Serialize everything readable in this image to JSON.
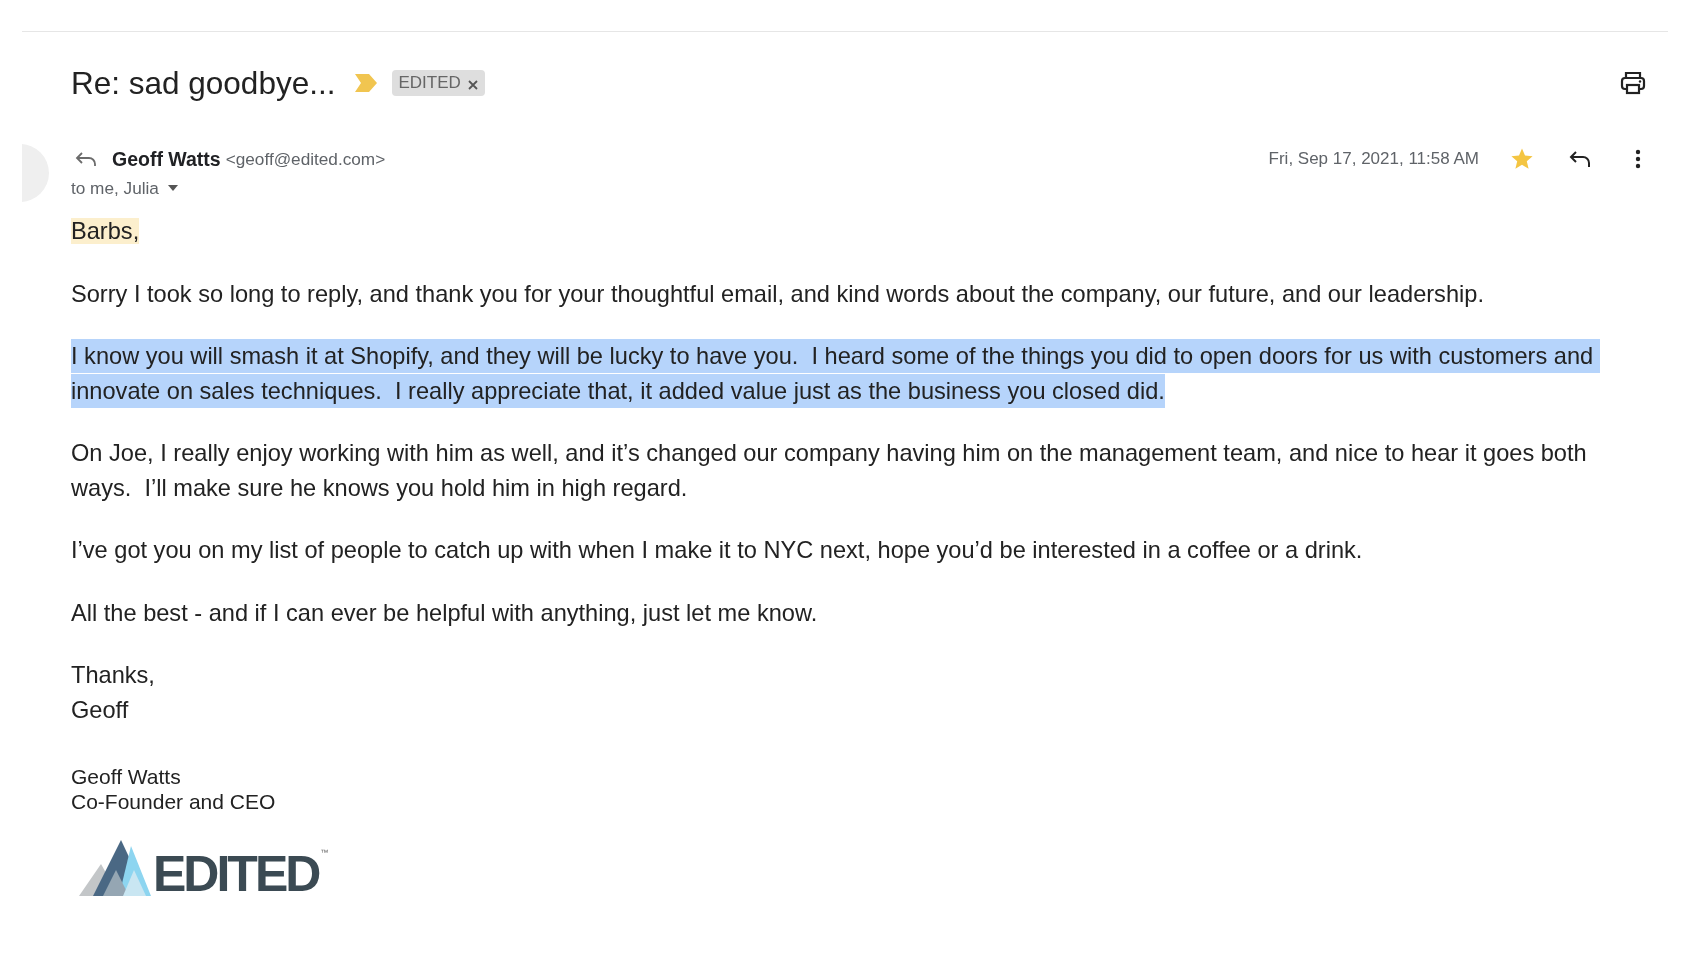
{
  "subject": {
    "title": "Re: sad goodbye...",
    "important": true,
    "labels": [
      {
        "text": "EDITED"
      }
    ]
  },
  "message": {
    "sender_name": "Geoff Watts",
    "sender_email": "<geoff@edited.com>",
    "recipients": "to me, Julia",
    "date": "Fri, Sep 17, 2021, 11:58 AM",
    "starred": true
  },
  "body": {
    "greeting": {
      "text": "Barbs,",
      "highlighted": true
    },
    "paragraphs": [
      {
        "text": "Sorry I took so long to reply, and thank you for your thoughtful email, and kind words about the company, our future, and our leadership.",
        "selected": false
      },
      {
        "text": "I know you will smash it at Shopify, and they will be lucky to have you.  I heard some of the things you did to open doors for us with customers and innovate on sales techniques.  I really appreciate that, it added value just as the business you closed did.",
        "selected": true
      },
      {
        "text": "On Joe, I really enjoy working with him as well, and it’s changed our company having him on the management team, and nice to hear it goes both ways.  I’ll make sure he knows you hold him in high regard.",
        "selected": false
      },
      {
        "text": "I’ve got you on my list of people to catch up with when I make it to NYC next, hope you’d be interested in a coffee or a drink.",
        "selected": false
      },
      {
        "text": "All the best - and if I can ever be helpful with anything, just let me know.",
        "selected": false
      }
    ],
    "closing": [
      "Thanks,",
      "Geoff"
    ]
  },
  "signature": {
    "lines": [
      "Geoff Watts",
      "Co-Founder and CEO"
    ],
    "logo_text": "EDITED",
    "logo_mark": "™"
  }
}
